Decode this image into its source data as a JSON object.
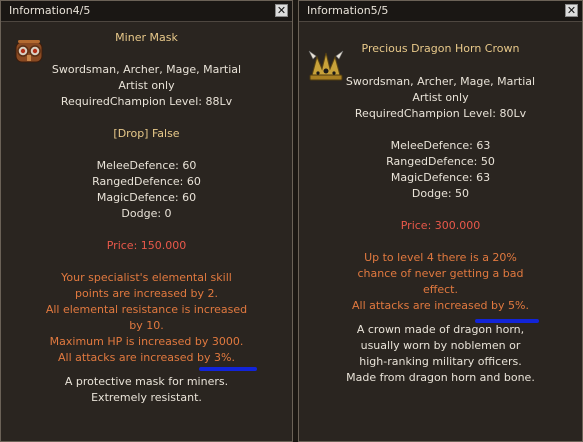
{
  "left": {
    "title": "Information4/5",
    "close_label": "✕",
    "icon": "miner-mask-icon",
    "item_name": "Miner Mask",
    "classes": [
      "Swordsman, Archer, Mage, Martial",
      "Artist only"
    ],
    "required_level": "RequiredChampion Level: 88Lv",
    "drop": "[Drop] False",
    "stats": [
      "MeleeDefence: 60",
      "RangedDefence: 60",
      "MagicDefence: 60",
      "Dodge: 0"
    ],
    "price": "Price: 150.000",
    "effects": [
      "Your specialist's elemental skill",
      "points are increased by 2.",
      "All elemental resistance is increased",
      "by 10.",
      "Maximum HP is increased by 3000.",
      "All attacks are increased by 3%."
    ],
    "description": [
      "A protective mask for miners.",
      "Extremely resistant."
    ]
  },
  "right": {
    "title": "Information5/5",
    "close_label": "✕",
    "icon": "dragon-horn-crown-icon",
    "item_name": "Precious Dragon Horn Crown",
    "classes": [
      "Swordsman, Archer, Mage, Martial",
      "Artist only"
    ],
    "required_level": "RequiredChampion Level: 80Lv",
    "stats": [
      "MeleeDefence: 63",
      "RangedDefence: 50",
      "MagicDefence: 63",
      "Dodge: 50"
    ],
    "price": "Price: 300.000",
    "effects": [
      "Up to level 4 there is a 20%",
      "chance of never getting a bad",
      "effect.",
      "All attacks are increased by 5%."
    ],
    "description": [
      "A crown made of dragon horn,",
      "usually worn by noblemen or",
      "high-ranking military officers.",
      "Made from dragon horn and bone."
    ]
  },
  "colors": {
    "panel_bg": "#2a2520",
    "item_name": "#e8c98a",
    "text": "#e9e3d8",
    "price": "#e8584a",
    "effect": "#e1793f",
    "annotation": "#1224d8"
  }
}
